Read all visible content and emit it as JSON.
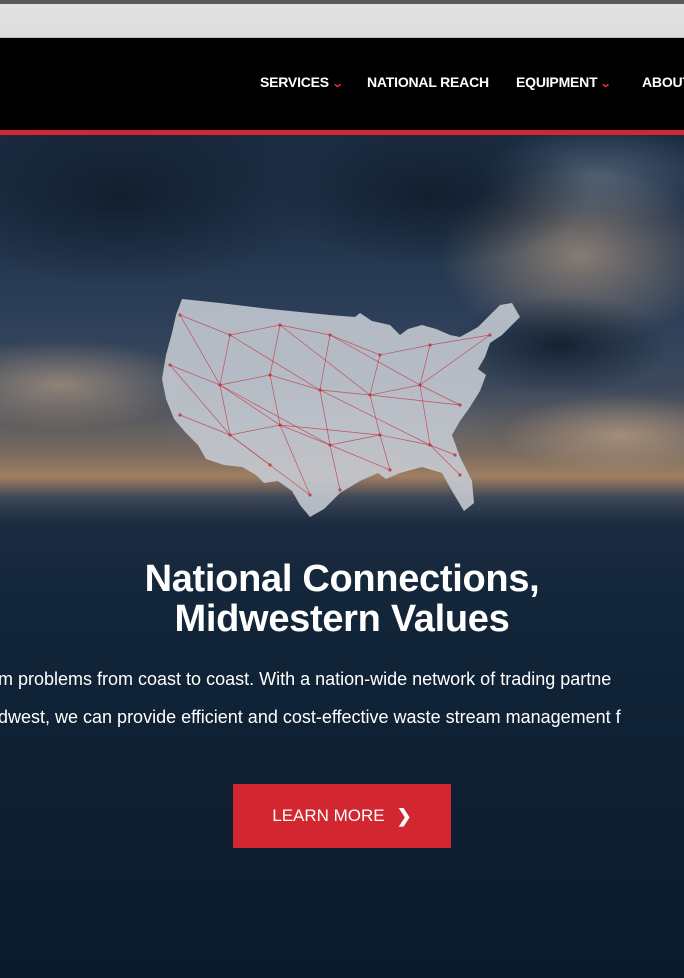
{
  "nav": {
    "items": [
      {
        "label": "SERVICES",
        "dropdown": true
      },
      {
        "label": "NATIONAL REACH",
        "dropdown": false
      },
      {
        "label": "EQUIPMENT",
        "dropdown": true
      },
      {
        "label": "ABOUT",
        "dropdown": false
      }
    ],
    "chevron_glyph": "⌄",
    "accent_color": "#d22630"
  },
  "hero": {
    "map_icon": "us-map-network",
    "headline_line1": "National Connections,",
    "headline_line2": "Midwestern Values",
    "body_line1": "m problems from coast to coast. With a nation-wide network of trading partne",
    "body_line2": "dwest, we can provide efficient and cost-effective waste stream management f",
    "cta_label": "LEARN MORE",
    "cta_icon": "chevron-right-icon",
    "cta_glyph": "❯"
  }
}
